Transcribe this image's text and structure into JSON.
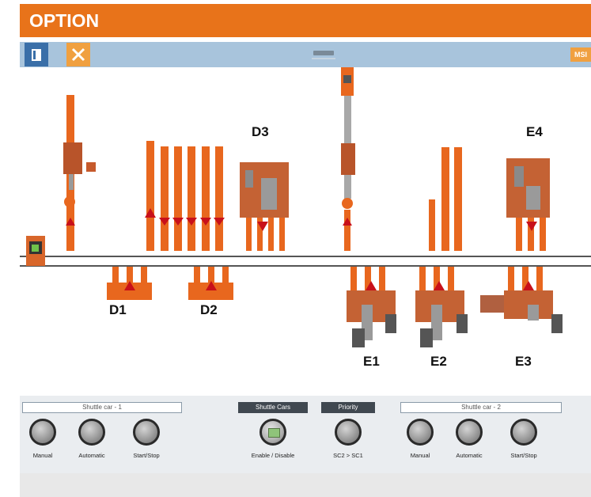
{
  "banner": {
    "title": "OPTION",
    "color": "#e8731a"
  },
  "toolbar": {
    "buttons": [
      {
        "icon": "panel-icon",
        "color": "#3a6fa8"
      },
      {
        "icon": "tools-icon",
        "color": "#f0a040"
      }
    ],
    "right_label": "MSI"
  },
  "zones": {
    "d1": "D1",
    "d2": "D2",
    "d3": "D3",
    "e1": "E1",
    "e2": "E2",
    "e3": "E3",
    "e4": "E4"
  },
  "controls": {
    "shuttle_car_1": {
      "title": "Shuttle car - 1",
      "buttons": [
        "Manual",
        "Automatic",
        "Start/Stop"
      ]
    },
    "shuttle_cars": {
      "title": "Shuttle Cars",
      "button": "Enable / Disable"
    },
    "priority": {
      "title": "Priority",
      "button": "SC2 > SC1"
    },
    "shuttle_car_2": {
      "title": "Shuttle car - 2",
      "buttons": [
        "Manual",
        "Automatic",
        "Start/Stop"
      ]
    }
  },
  "colors": {
    "accent": "#e8731a",
    "equipment_orange": "#e8671e",
    "rail": "#555555",
    "toolbar": "#a8c4dc"
  }
}
